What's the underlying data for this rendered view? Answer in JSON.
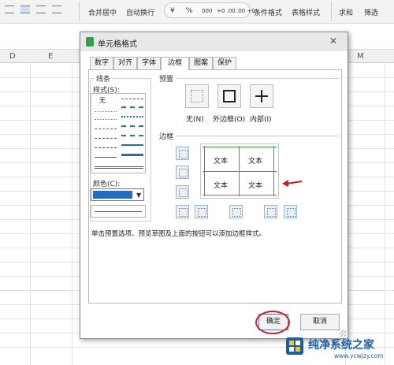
{
  "ribbon": {
    "merge_label": "合并居中",
    "wrap_label": "自动换行",
    "currency_symbol": "¥",
    "percent_symbol": "%",
    "thousands_symbol": "000",
    "inc_decimal": "+0 .00",
    "dec_decimal": ".00 +0",
    "cond_format_label": "条件格式",
    "table_style_label": "表格样式",
    "sum_label": "求和",
    "filter_label": "筛选"
  },
  "columns": [
    "D",
    "E",
    "M"
  ],
  "dialog": {
    "title": "单元格格式",
    "close": "✕",
    "tabs": [
      "数字",
      "对齐",
      "字体",
      "边框",
      "图案",
      "保护"
    ],
    "active_tab": "边框",
    "line_group": "线条",
    "style_label": "样式(S):",
    "style_none": "无",
    "color_label": "颜色(C):",
    "color_value": "#1f6ec0",
    "preset_group": "预置",
    "presets": [
      "无(N)",
      "外边框(O)",
      "内部(I)"
    ],
    "border_group": "边框",
    "preview_cells": [
      "文本",
      "文本",
      "文本",
      "文本"
    ],
    "hint": "单击预置选项、预览草图及上面的按钮可以添加边框样式。",
    "ok": "确定",
    "cancel": "取消",
    "border_color": "#3aa052"
  },
  "watermark": {
    "title": "纯净系统之家",
    "url": "www.ycwjzy.com"
  }
}
